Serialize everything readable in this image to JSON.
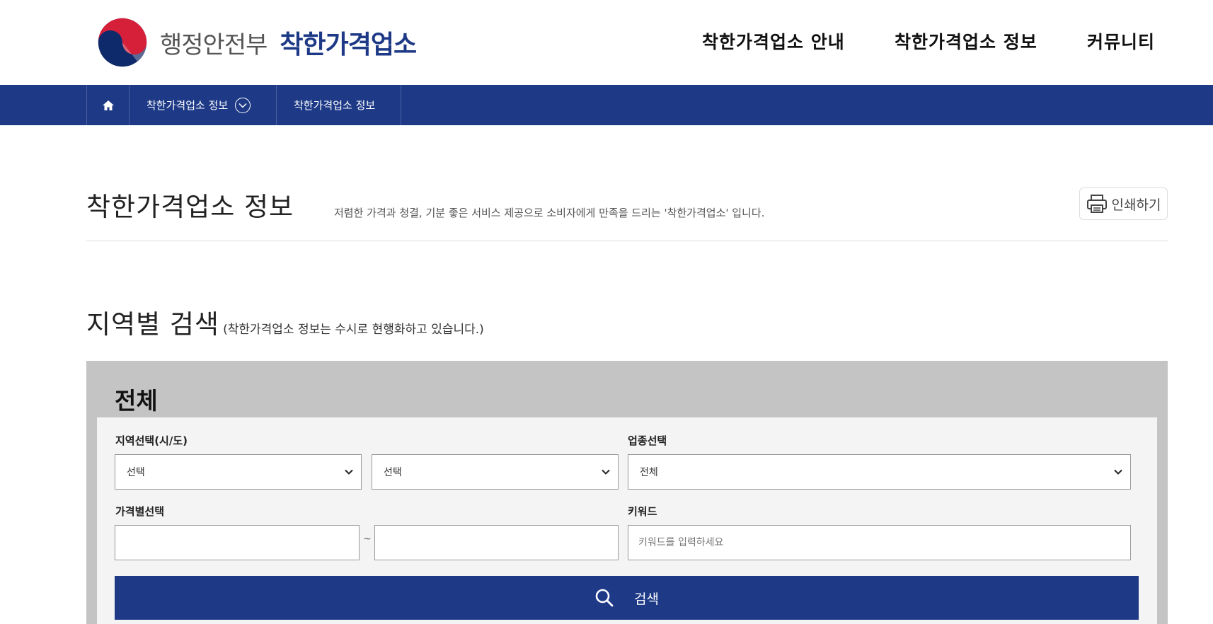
{
  "header": {
    "ministry": "행정안전부",
    "brand": "착한가격업소",
    "menu": [
      "착한가격업소 안내",
      "착한가격업소 정보",
      "커뮤니티"
    ]
  },
  "breadcrumb": {
    "home_icon": "home-icon",
    "items": [
      "착한가격업소 정보",
      "착한가격업소 정보"
    ]
  },
  "page": {
    "title": "착한가격업소 정보",
    "description": "저렴한 가격과 청결, 기분 좋은 서비스 제공으로 소비자에게 만족을 드리는 '착한가격업소' 입니다.",
    "print_label": "인쇄하기"
  },
  "search": {
    "section_title": "지역별 검색",
    "section_note": "(착한가격업소 정보는 수시로 현행화하고 있습니다.)",
    "box_title": "전체",
    "region_label": "지역선택(시/도)",
    "region1_value": "선택",
    "region2_value": "선택",
    "category_label": "업종선택",
    "category_value": "전체",
    "price_label": "가격별선택",
    "price_separator": "~",
    "price_min": "",
    "price_max": "",
    "keyword_label": "키워드",
    "keyword_placeholder": "키워드를 입력하세요",
    "search_button": "검색"
  },
  "colors": {
    "primary": "#1e3a87",
    "search_box_bg": "#c4c4c4",
    "inner_bg": "#f4f4f4"
  }
}
